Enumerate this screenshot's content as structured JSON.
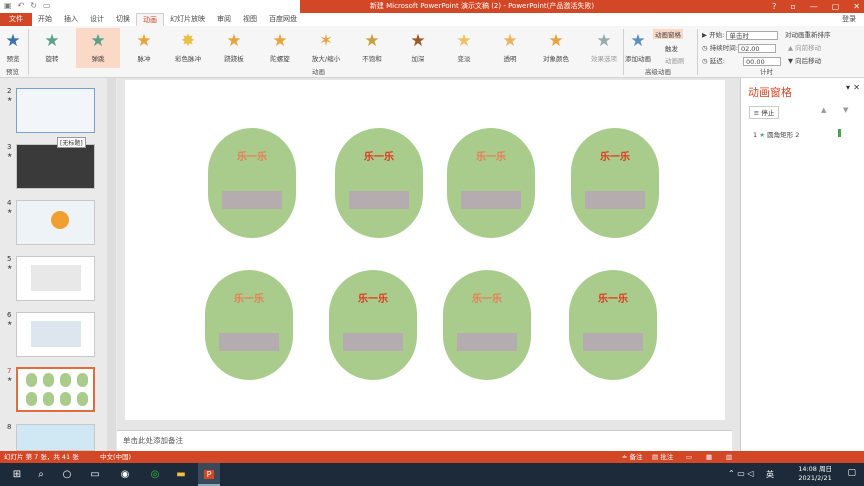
{
  "titlebar": {
    "title": "新建 Microsoft PowerPoint 演示文稿 (2) - PowerPoint(产品激活失败)"
  },
  "tabs": {
    "file": "文件",
    "items": [
      "开始",
      "插入",
      "设计",
      "切换",
      "动画",
      "幻灯片放映",
      "审阅",
      "视图",
      "百度网盘"
    ],
    "active": "动画",
    "login": "登录"
  },
  "ribbon": {
    "preview": "预览",
    "effects": [
      "旋转",
      "弹跳",
      "脉冲",
      "彩色脉冲",
      "跷跷板",
      "陀螺旋",
      "放大/缩小",
      "不饱和",
      "加深",
      "变淡",
      "透明",
      "对象颜色"
    ],
    "selected_effect": "弹跳",
    "effect_options": "效果选项",
    "add_animation": "添加动画",
    "animation_pane": "动画窗格",
    "trigger": "触发",
    "animation_painter": "动画刷",
    "start_label": "开始:",
    "start_value": "单击时",
    "duration_label": "持续时间:",
    "duration_value": "02.00",
    "delay_label": "延迟:",
    "delay_value": "00.00",
    "reorder": "对动画重新排序",
    "move_earlier": "向前移动",
    "move_later": "向后移动",
    "groups": {
      "preview": "预览",
      "animation": "动画",
      "advanced": "高级动画",
      "timing": "计时"
    }
  },
  "thumbs": {
    "numbers": [
      "2",
      "3",
      "4",
      "5",
      "6",
      "7",
      "8"
    ],
    "selected": "7",
    "tooltip": "[无标题]"
  },
  "slide": {
    "shapes": [
      {
        "label": "乐一乐",
        "style": "pale"
      },
      {
        "label": "乐一乐",
        "style": "bold"
      },
      {
        "label": "乐一乐",
        "style": "pale"
      },
      {
        "label": "乐一乐",
        "style": "bold"
      },
      {
        "label": "乐一乐",
        "style": "pale"
      },
      {
        "label": "乐一乐",
        "style": "bold"
      },
      {
        "label": "乐一乐",
        "style": "pale"
      },
      {
        "label": "乐一乐",
        "style": "bold"
      }
    ]
  },
  "notes": {
    "placeholder": "单击此处添加备注"
  },
  "anim_pane": {
    "title": "动画窗格",
    "stop": "停止",
    "item_num": "1",
    "item_label": "圆角矩形 2"
  },
  "statusbar": {
    "slide_info": "幻灯片 第 7 张，共 41 张",
    "lang": "中文(中国)",
    "notes": "备注",
    "comments": "批注"
  },
  "taskbar": {
    "time": "14:08 周日",
    "date": "2021/2/21",
    "ime": "英"
  }
}
